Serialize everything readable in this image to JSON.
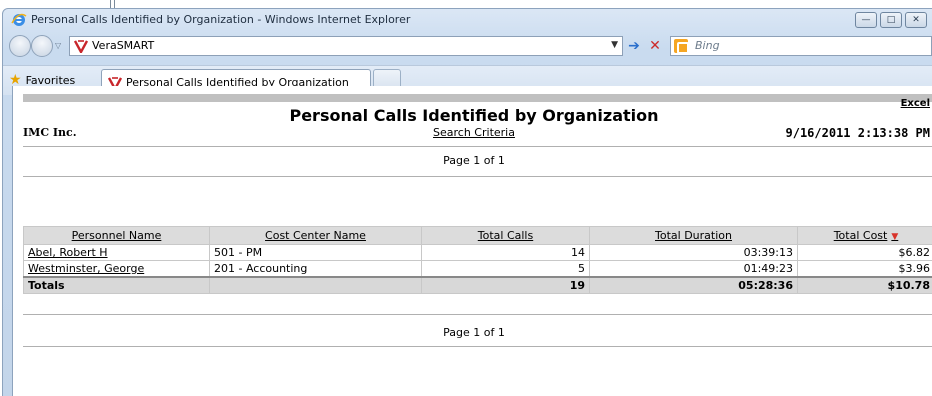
{
  "browser": {
    "window_title": "Personal Calls Identified by Organization - Windows Internet Explorer",
    "address": "VeraSMART",
    "search_placeholder": "Bing",
    "favorites_label": "Favorites",
    "tab_title": "Personal Calls Identified by Organization"
  },
  "report": {
    "export_label": "Excel",
    "title": "Personal Calls Identified by Organization",
    "organization": "IMC Inc.",
    "criteria_link": "Search Criteria",
    "generated": "9/16/2011 2:13:38 PM",
    "page_top": "Page 1 of 1",
    "page_bottom": "Page 1 of 1",
    "columns": [
      "Personnel Name",
      "Cost Center Name",
      "Total Calls",
      "Total Duration",
      "Total Cost"
    ],
    "sort_column": "Total Cost",
    "rows": [
      {
        "name": "Abel, Robert H",
        "cost_center": "501 - PM",
        "calls": "14",
        "duration": "03:39:13",
        "cost": "$6.82"
      },
      {
        "name": "Westminster, George",
        "cost_center": "201 - Accounting",
        "calls": "5",
        "duration": "01:49:23",
        "cost": "$3.96"
      }
    ],
    "totals": {
      "label": "Totals",
      "cost_center": "",
      "calls": "19",
      "duration": "05:28:36",
      "cost": "$10.78"
    }
  },
  "colors": {
    "accent_red": "#d9342b",
    "header_gray": "#dcdcdc",
    "chrome_blue": "#c9dbef"
  }
}
